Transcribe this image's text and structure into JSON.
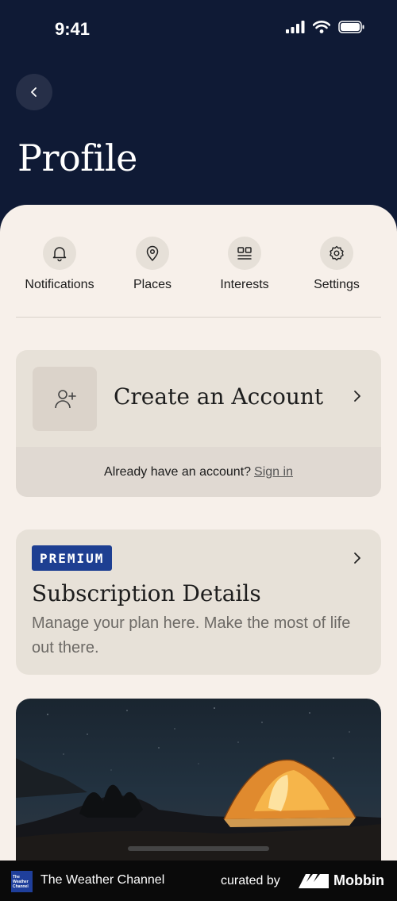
{
  "status_bar": {
    "time": "9:41"
  },
  "header": {
    "title": "Profile"
  },
  "quick_nav": [
    {
      "label": "Notifications",
      "icon": "bell-icon"
    },
    {
      "label": "Places",
      "icon": "location-pin-icon"
    },
    {
      "label": "Interests",
      "icon": "interests-grid-icon"
    },
    {
      "label": "Settings",
      "icon": "gear-icon"
    }
  ],
  "account_card": {
    "title": "Create an Account",
    "prompt": "Already have an account?",
    "signin_link": "Sign in"
  },
  "subscription_card": {
    "badge": "PREMIUM",
    "title": "Subscription Details",
    "description": "Manage your plan here. Make the most of life out there."
  },
  "colors": {
    "header_bg": "#0f1a35",
    "sheet_bg": "#f7f0ea",
    "card_bg": "#e7e1d8",
    "premium_badge": "#1e3f92"
  },
  "footer_bar": {
    "app_logo_text": "The Weather Channel",
    "app_name": "The Weather Channel",
    "curated_label": "curated by",
    "brand": "Mobbin"
  }
}
